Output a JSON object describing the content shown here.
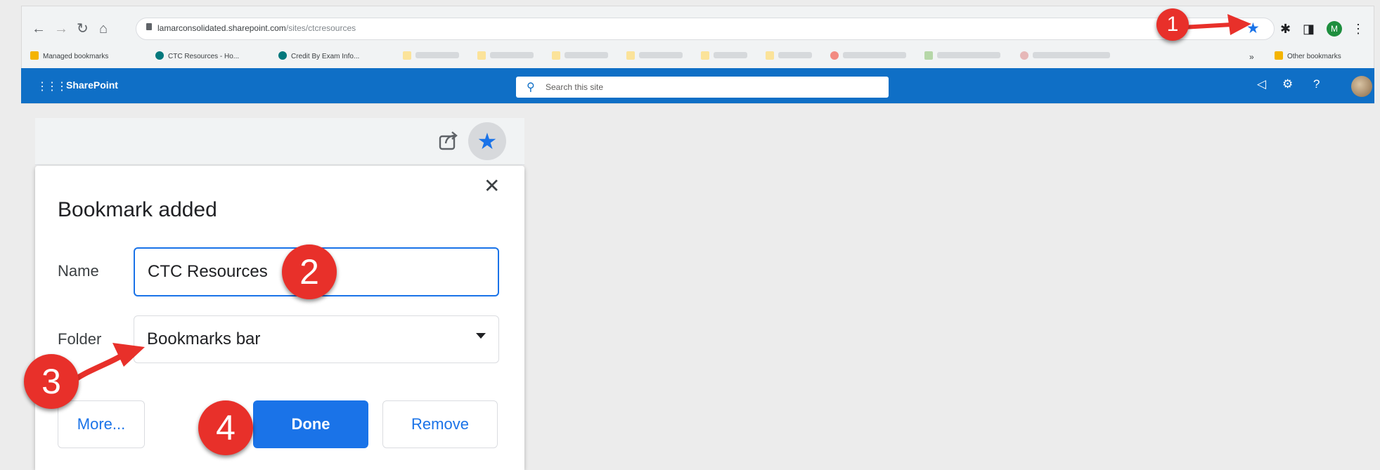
{
  "browser": {
    "url_domain": "lamarconsolidated.sharepoint.com",
    "url_path": "/sites/ctcresources",
    "profile_initial": "M",
    "bookmarks": [
      {
        "label": "Managed bookmarks",
        "color": "#f4b400"
      },
      {
        "label": "CTC Resources - Ho...",
        "color": "#03787c"
      },
      {
        "label": "Credit By Exam Info...",
        "color": "#03787c"
      }
    ],
    "other_bookmarks": "Other bookmarks",
    "overflow": "»"
  },
  "sharepoint": {
    "app_name": "SharePoint",
    "search_placeholder": "Search this site"
  },
  "dialog": {
    "title": "Bookmark added",
    "name_label": "Name",
    "name_value": "CTC Resources",
    "folder_label": "Folder",
    "folder_value": "Bookmarks bar",
    "more_label": "More...",
    "done_label": "Done",
    "remove_label": "Remove",
    "close_symbol": "✕"
  },
  "callouts": [
    "1",
    "2",
    "3",
    "4"
  ],
  "colors": {
    "sharepoint_blue": "#0f6fc6",
    "chrome_blue": "#1a73e8",
    "callout_red": "#e8302a"
  }
}
